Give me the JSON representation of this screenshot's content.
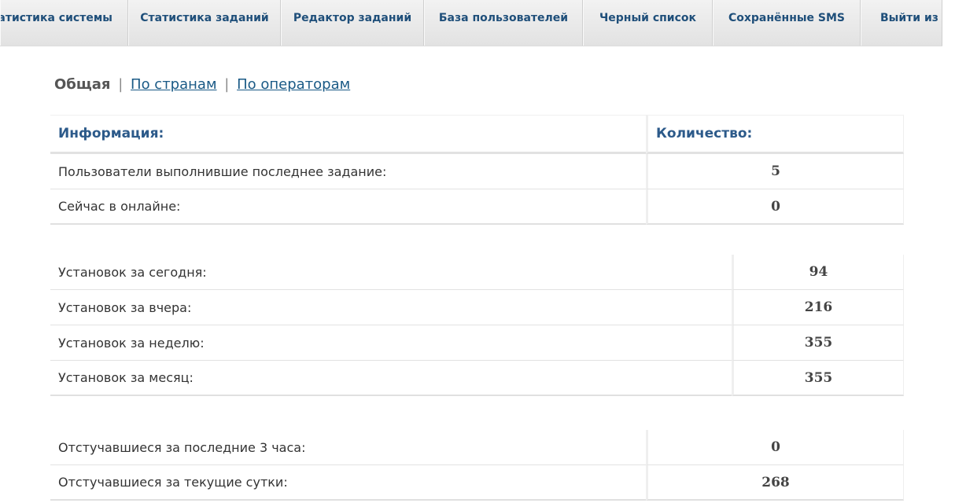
{
  "nav": {
    "items": [
      {
        "label": "Статистика системы"
      },
      {
        "label": "Статистика заданий"
      },
      {
        "label": "Редактор заданий"
      },
      {
        "label": "База пользователей"
      },
      {
        "label": "Черный список"
      },
      {
        "label": "Сохранённые SMS"
      },
      {
        "label": "Выйти из системы"
      }
    ]
  },
  "subtabs": {
    "active": "Общая",
    "separator": "|",
    "by_countries": "По странам",
    "by_operators": "По операторам"
  },
  "table_main": {
    "header": {
      "info": "Информация:",
      "count": "Количество:"
    },
    "rows": [
      {
        "label": "Пользователи выполнившие последнее задание:",
        "value": "5"
      },
      {
        "label": "Сейчас в онлайне:",
        "value": "0"
      }
    ]
  },
  "table_installs": {
    "rows": [
      {
        "label": "Установок за сегодня:",
        "value": "94"
      },
      {
        "label": "Установок за вчера:",
        "value": "216"
      },
      {
        "label": "Установок за неделю:",
        "value": "355"
      },
      {
        "label": "Установок за месяц:",
        "value": "355"
      }
    ]
  },
  "table_checkins": {
    "rows": [
      {
        "label": "Отстучавшиеся за последние 3 часа:",
        "value": "0"
      },
      {
        "label": "Отстучавшиеся за текущие сутки:",
        "value": "268"
      }
    ]
  }
}
